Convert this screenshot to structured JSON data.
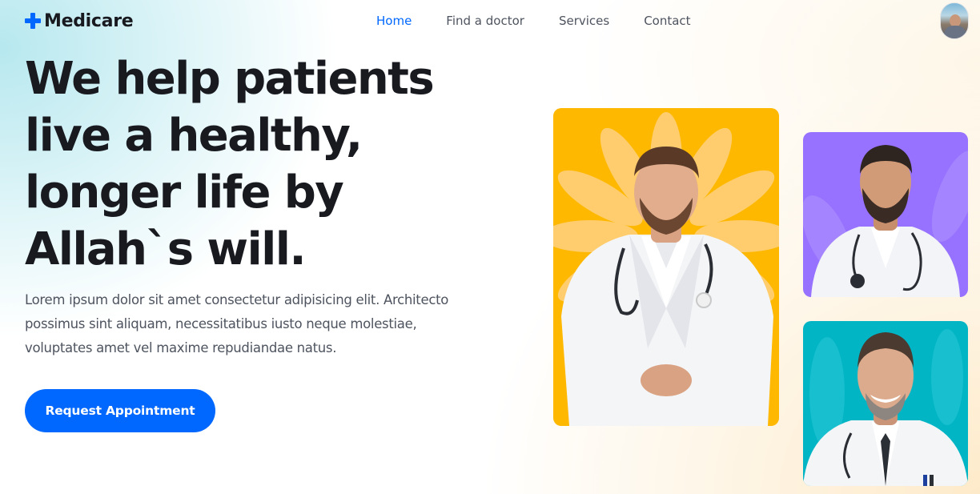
{
  "brand": {
    "name": "Medicare",
    "icon": "plus-icon",
    "accent": "#0067ff"
  },
  "nav": {
    "items": [
      {
        "label": "Home",
        "active": true
      },
      {
        "label": "Find a doctor",
        "active": false
      },
      {
        "label": "Services",
        "active": false
      },
      {
        "label": "Contact",
        "active": false
      }
    ]
  },
  "user": {
    "avatar": "user-avatar-photo"
  },
  "hero": {
    "title_lines": [
      "We help patients",
      "live a healthy,",
      "longer life by",
      "Allah`s will."
    ],
    "description_lines": [
      "Lorem ipsum dolor sit amet consectetur adipisicing elit. Architecto",
      "possimus sint aliquam, necessitatibus iusto neque molestiae,",
      "voluptates amet vel maxime repudiandae natus."
    ],
    "cta_label": "Request Appointment"
  },
  "doctors": [
    {
      "image": "doctor-photo-1",
      "background": "#ffb800"
    },
    {
      "image": "doctor-photo-2",
      "background": "#9771ff"
    },
    {
      "image": "doctor-photo-3",
      "background": "#01b5c5"
    }
  ]
}
